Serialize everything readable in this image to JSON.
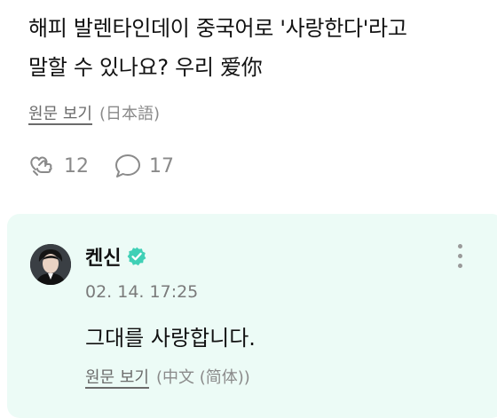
{
  "post": {
    "line1": "해피 발렌타인데이 중국어로 '사랑한다'라고",
    "line2": "말할 수 있나요? 우리 爱你",
    "translate_link": "원문 보기",
    "translate_lang": "(日本語)",
    "likes_count": "12",
    "comments_count": "17"
  },
  "reply": {
    "author_name": "켄신",
    "verified": true,
    "timestamp": "02. 14. 17:25",
    "text": "그대를 사랑합니다.",
    "translate_link": "원문 보기",
    "translate_lang": "(中文 (简体))"
  },
  "colors": {
    "card_background": "#ecfbf6",
    "verified_badge": "#3fd0b6",
    "muted_text": "#8a8a8a"
  }
}
